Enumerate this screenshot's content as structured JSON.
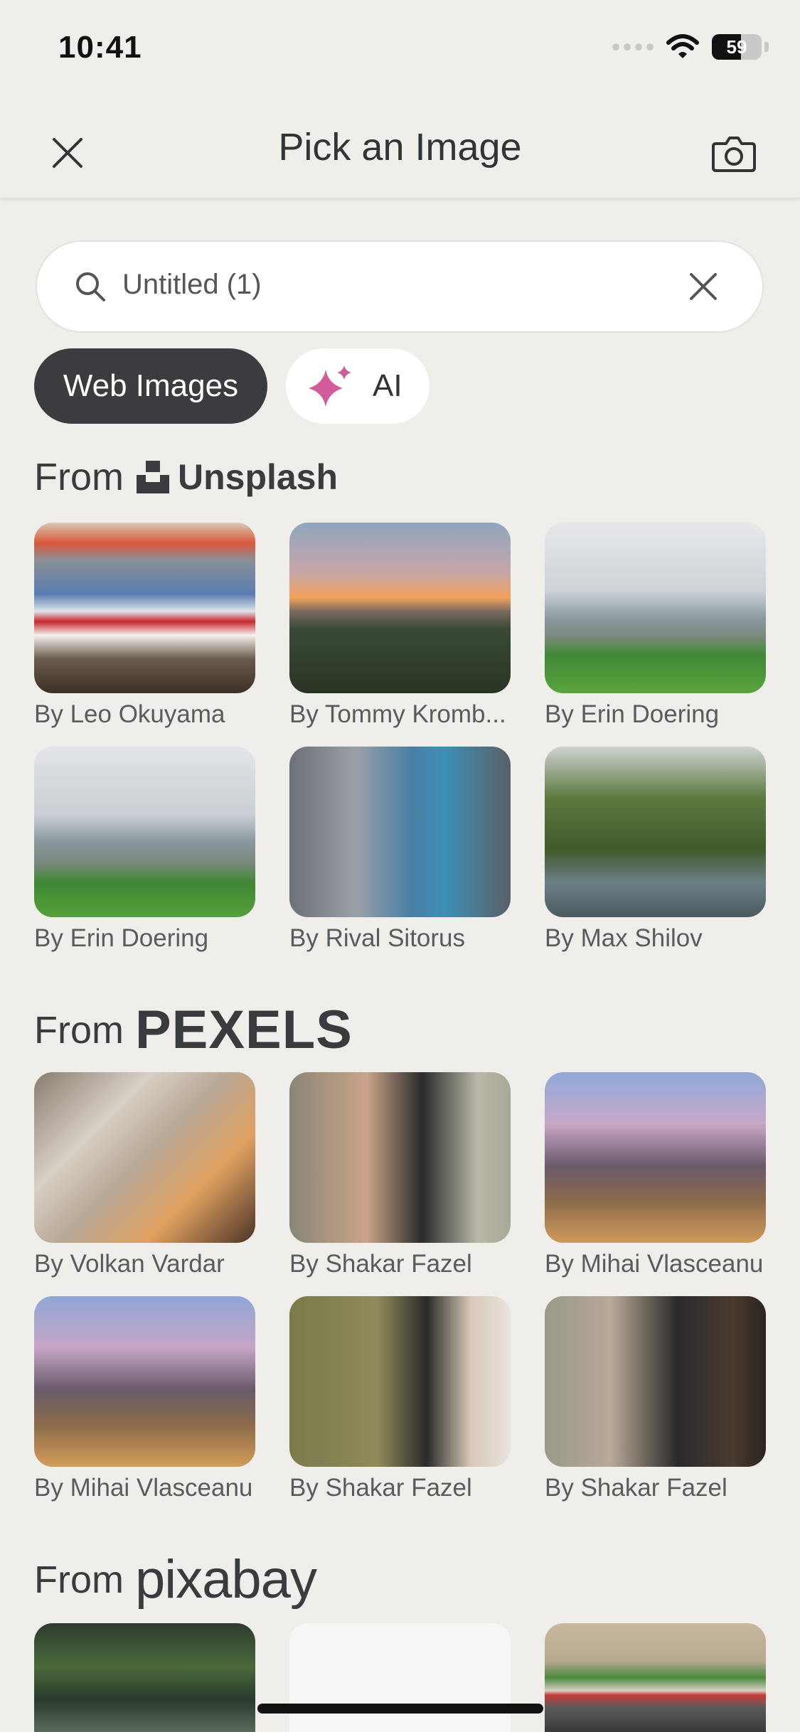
{
  "status": {
    "time": "10:41",
    "battery": "59",
    "battery_level": 0.59
  },
  "header": {
    "title": "Pick an Image",
    "close_icon": "close-icon",
    "camera_icon": "camera-icon"
  },
  "search": {
    "value": "Untitled (1)"
  },
  "filters": {
    "web_images": "Web Images",
    "ai": "AI"
  },
  "sections": {
    "unsplash": {
      "from": "From",
      "brand": "Unsplash",
      "items": [
        {
          "caption": "By Leo Okuyama"
        },
        {
          "caption": "By Tommy Kromb..."
        },
        {
          "caption": "By Erin Doering"
        },
        {
          "caption": "By Erin Doering"
        },
        {
          "caption": "By Rival Sitorus"
        },
        {
          "caption": "By Max Shilov"
        }
      ]
    },
    "pexels": {
      "from": "From",
      "brand": "PEXELS",
      "items": [
        {
          "caption": "By Volkan Vardar"
        },
        {
          "caption": "By Shakar Fazel"
        },
        {
          "caption": "By Mihai Vlasceanu"
        },
        {
          "caption": "By Mihai Vlasceanu"
        },
        {
          "caption": "By Shakar Fazel"
        },
        {
          "caption": "By Shakar Fazel"
        }
      ]
    },
    "pixabay": {
      "from": "From",
      "brand": "pixabay"
    }
  },
  "colors": {
    "background": "#f0eeeb",
    "active_pill": "#3b3c40",
    "ai_sparkle": "#d35b9b"
  }
}
